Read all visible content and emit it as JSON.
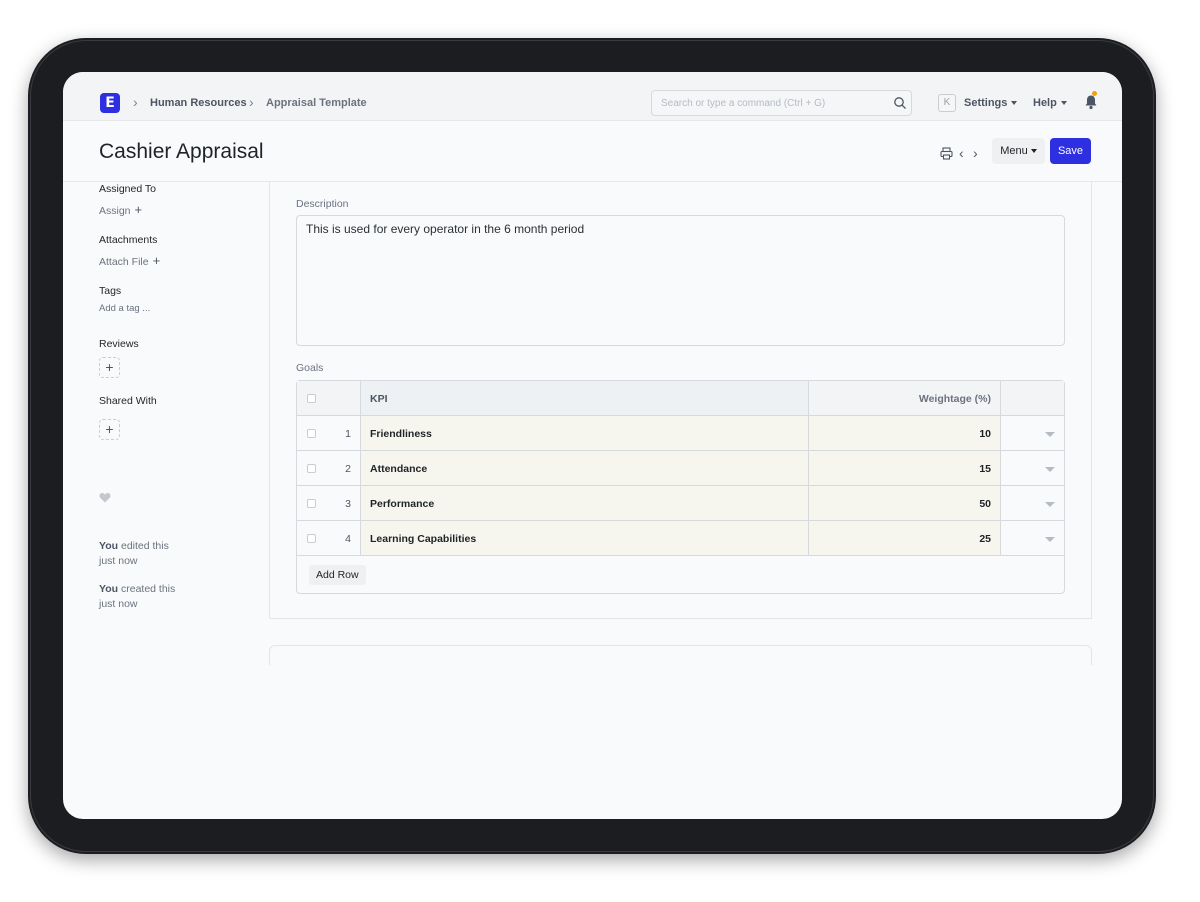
{
  "navbar": {
    "logo_letter": "E",
    "breadcrumbs": [
      "Human Resources",
      "Appraisal Template"
    ],
    "search_placeholder": "Search or type a command (Ctrl + G)",
    "avatar_letter": "K",
    "settings_label": "Settings",
    "help_label": "Help"
  },
  "page": {
    "title": "Cashier Appraisal",
    "menu_label": "Menu",
    "save_label": "Save"
  },
  "sidebar": {
    "assigned_to": "Assigned To",
    "assign": "Assign",
    "attachments": "Attachments",
    "attach_file": "Attach File",
    "tags": "Tags",
    "add_tag": "Add a tag ...",
    "reviews": "Reviews",
    "shared_with": "Shared With",
    "activity": [
      {
        "who": "You",
        "what": "edited this",
        "when": "just now"
      },
      {
        "who": "You",
        "what": "created this",
        "when": "just now"
      }
    ]
  },
  "form": {
    "description_label": "Description",
    "description_value": "This is used for every operator in the 6 month period",
    "goals_label": "Goals",
    "goals_headers": {
      "kpi": "KPI",
      "weightage": "Weightage (%)"
    },
    "goals": [
      {
        "idx": "1",
        "kpi": "Friendliness",
        "weightage": "10"
      },
      {
        "idx": "2",
        "kpi": "Attendance",
        "weightage": "15"
      },
      {
        "idx": "3",
        "kpi": "Performance",
        "weightage": "50"
      },
      {
        "idx": "4",
        "kpi": "Learning Capabilities",
        "weightage": "25"
      }
    ],
    "add_row_label": "Add Row"
  },
  "colors": {
    "accent": "#2d2fe0",
    "notification_dot": "#f59e0b"
  }
}
